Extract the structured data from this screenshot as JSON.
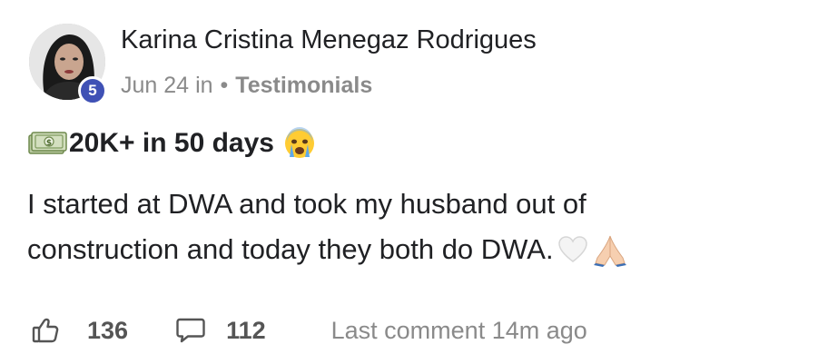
{
  "author": {
    "name": "Karina Cristina Menegaz Rodrigues",
    "level": "5",
    "avatar_icon": "user-portrait-avatar"
  },
  "meta": {
    "date": "Jun 24",
    "in_word": "in",
    "separator": "•",
    "category": "Testimonials"
  },
  "post": {
    "title_icon_start": "money-bills-icon",
    "title": "20K+ in 50 days",
    "title_icon_end": "crying-face-icon",
    "body_line_1": "I started at DWA and took my husband out of",
    "body_line_2": "construction and today they both do DWA.",
    "body_icons": [
      "white-heart-icon",
      "praying-hands-icon"
    ]
  },
  "footer": {
    "like_icon": "thumbs-up-icon",
    "like_count": "136",
    "comment_icon": "comment-bubble-icon",
    "comment_count": "112",
    "last_comment": "Last comment 14m ago"
  },
  "colors": {
    "badge": "#3f51b5",
    "text": "#202124",
    "muted": "#8a8a8a"
  }
}
